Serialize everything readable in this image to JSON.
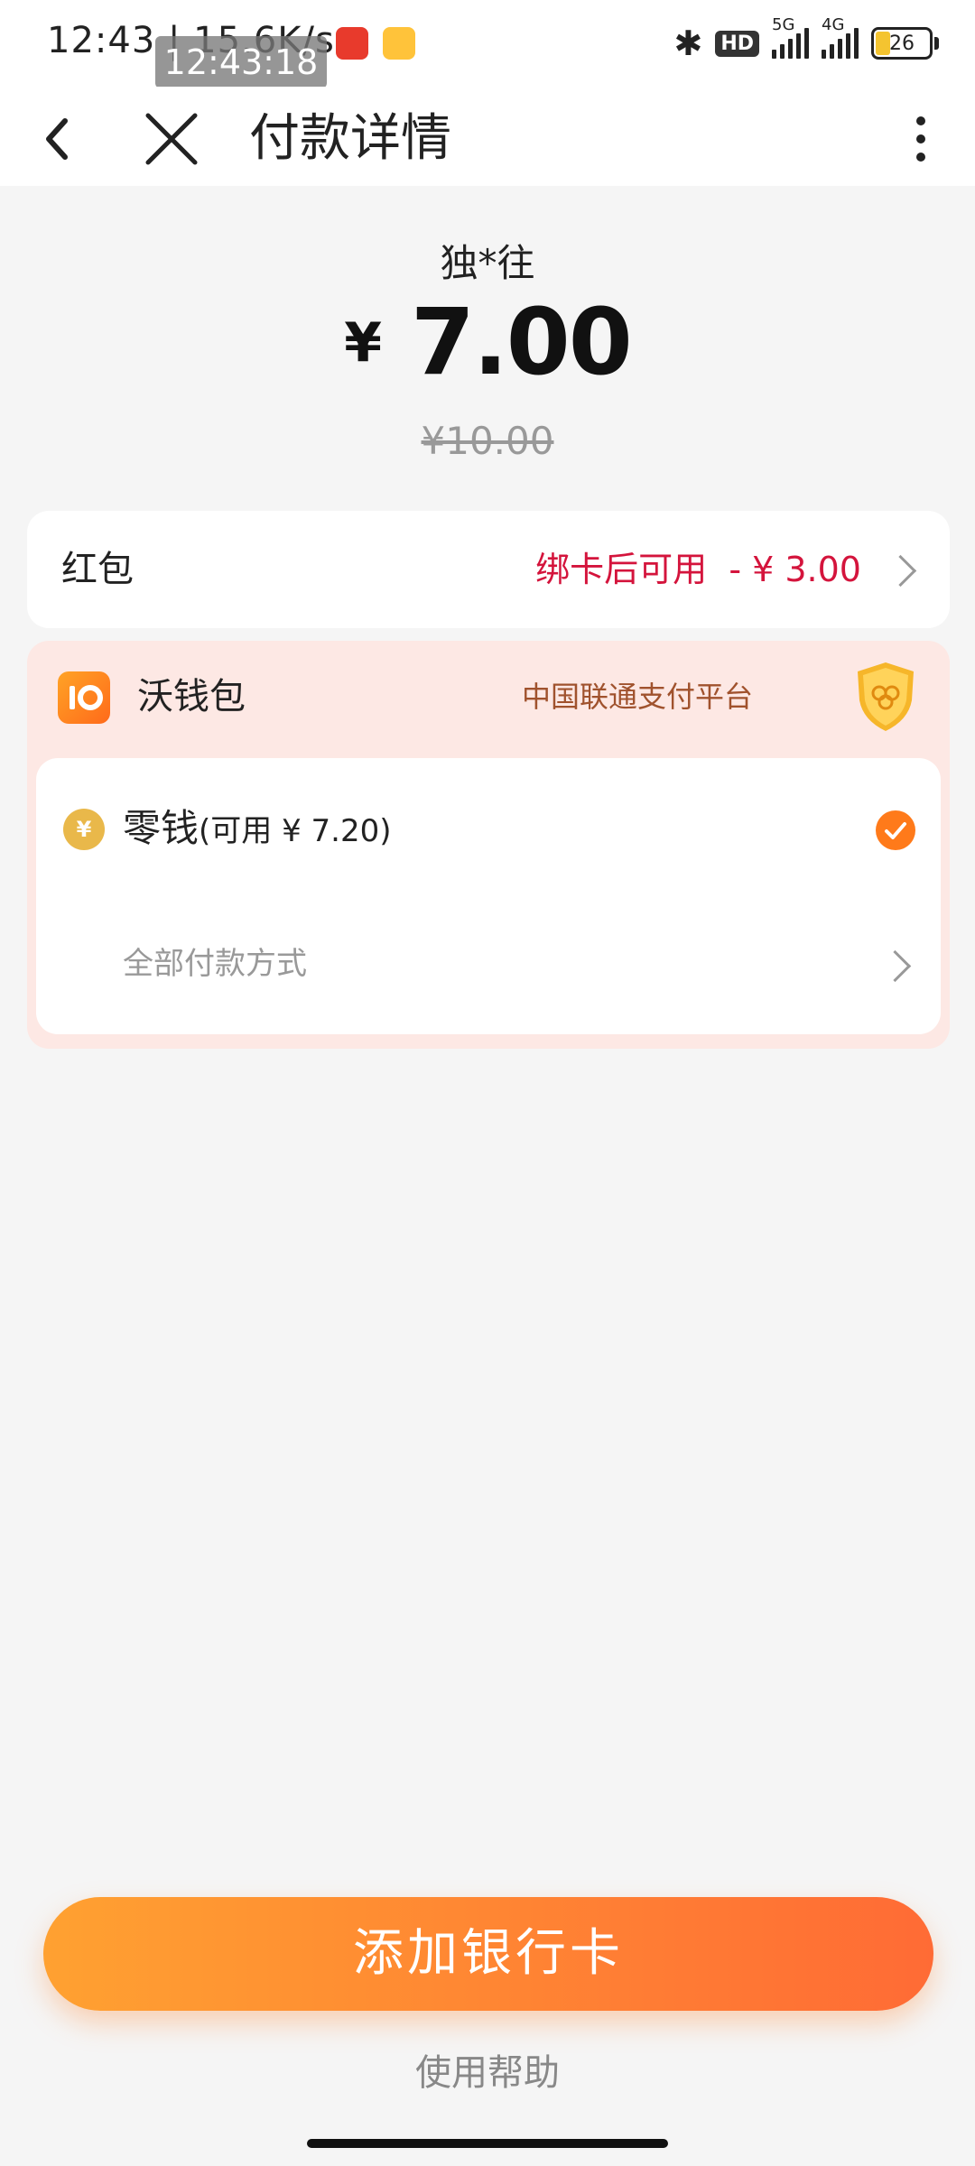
{
  "status_bar": {
    "time": "12:43 | 15.6K/s",
    "overlay_time": "12:43:18",
    "network_5g": "5G",
    "network_4g": "4G",
    "hd_badge": "HD",
    "battery": "26"
  },
  "header": {
    "title": "付款详情",
    "icons": [
      "back-icon",
      "close-icon",
      "more-icon"
    ]
  },
  "payment": {
    "merchant": "独*往",
    "currency": "¥",
    "amount": "7.00",
    "original_amount": "¥10.00"
  },
  "hongbao": {
    "label": "红包",
    "hint": "绑卡后可用  - ¥ 3.00"
  },
  "wallet": {
    "name": "沃钱包",
    "platform": "中国联通支付平台",
    "change_label": "零钱",
    "change_available": "(可用 ¥ 7.20)",
    "coin_symbol": "¥",
    "all_methods": "全部付款方式"
  },
  "actions": {
    "add_card": "添加银行卡",
    "help": "使用帮助"
  },
  "colors": {
    "accent": "#ff7a1a",
    "discount_red": "#d4143c",
    "wallet_bg": "#fde8e4"
  }
}
